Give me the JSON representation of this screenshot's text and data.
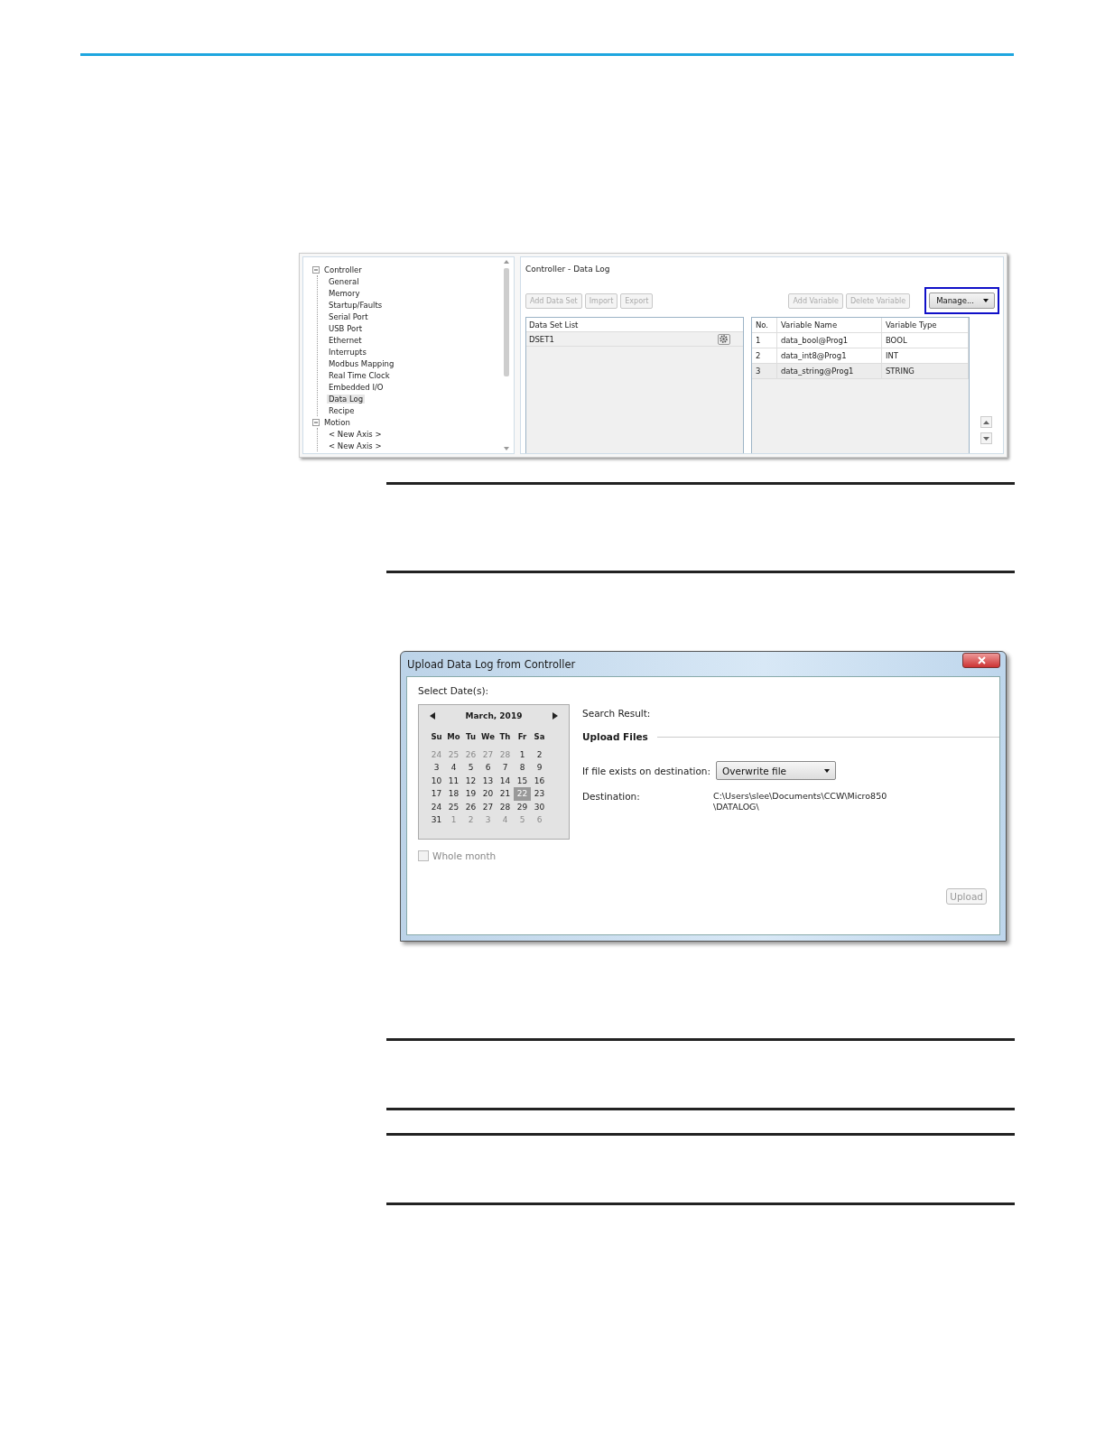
{
  "project_tree": {
    "items": [
      {
        "label": "Controller",
        "expanded": true,
        "selected": false,
        "children": [
          {
            "label": "General",
            "selected": false
          },
          {
            "label": "Memory",
            "selected": false
          },
          {
            "label": "Startup/Faults",
            "selected": false
          },
          {
            "label": "Serial Port",
            "selected": false
          },
          {
            "label": "USB Port",
            "selected": false
          },
          {
            "label": "Ethernet",
            "selected": false
          },
          {
            "label": "Interrupts",
            "selected": false
          },
          {
            "label": "Modbus Mapping",
            "selected": false
          },
          {
            "label": "Real Time Clock",
            "selected": false
          },
          {
            "label": "Embedded I/O",
            "selected": false
          },
          {
            "label": "Data Log",
            "selected": true
          },
          {
            "label": "Recipe",
            "selected": false
          }
        ]
      },
      {
        "label": "Motion",
        "expanded": true,
        "selected": false,
        "children": [
          {
            "label": "< New Axis >",
            "selected": false
          },
          {
            "label": "< New Axis >",
            "selected": false
          }
        ]
      }
    ]
  },
  "data_log_panel": {
    "title": "Controller - Data Log",
    "left_buttons": [
      {
        "label": "Add Data Set",
        "disabled": true
      },
      {
        "label": "Import",
        "disabled": true
      },
      {
        "label": "Export",
        "disabled": true
      }
    ],
    "right_buttons": [
      {
        "label": "Add Variable",
        "disabled": true
      },
      {
        "label": "Delete Variable",
        "disabled": true
      }
    ],
    "manage_button": {
      "label": "Manage...",
      "highlighted": true
    },
    "data_set_list": {
      "header": "Data Set List",
      "rows": [
        {
          "name": "DSET1"
        }
      ]
    },
    "variables": {
      "columns": [
        "No.",
        "Variable Name",
        "Variable Type"
      ],
      "rows": [
        {
          "no": "1",
          "name": "data_bool@Prog1",
          "type": "BOOL",
          "selected": false
        },
        {
          "no": "2",
          "name": "data_int8@Prog1",
          "type": "INT",
          "selected": false
        },
        {
          "no": "3",
          "name": "data_string@Prog1",
          "type": "STRING",
          "selected": true
        }
      ]
    }
  },
  "upload_dialog": {
    "title": "Upload Data Log from Controller",
    "select_label": "Select Date(s):",
    "calendar": {
      "month": "March, 2019",
      "weekdays": [
        "Su",
        "Mo",
        "Tu",
        "We",
        "Th",
        "Fr",
        "Sa"
      ],
      "weeks": [
        [
          {
            "label": "24",
            "muted": true,
            "selected": false
          },
          {
            "label": "25",
            "muted": true,
            "selected": false
          },
          {
            "label": "26",
            "muted": true,
            "selected": false
          },
          {
            "label": "27",
            "muted": true,
            "selected": false
          },
          {
            "label": "28",
            "muted": true,
            "selected": false
          },
          {
            "label": "1",
            "muted": false,
            "selected": false
          },
          {
            "label": "2",
            "muted": false,
            "selected": false
          }
        ],
        [
          {
            "label": "3",
            "muted": false,
            "selected": false
          },
          {
            "label": "4",
            "muted": false,
            "selected": false
          },
          {
            "label": "5",
            "muted": false,
            "selected": false
          },
          {
            "label": "6",
            "muted": false,
            "selected": false
          },
          {
            "label": "7",
            "muted": false,
            "selected": false
          },
          {
            "label": "8",
            "muted": false,
            "selected": false
          },
          {
            "label": "9",
            "muted": false,
            "selected": false
          }
        ],
        [
          {
            "label": "10",
            "muted": false,
            "selected": false
          },
          {
            "label": "11",
            "muted": false,
            "selected": false
          },
          {
            "label": "12",
            "muted": false,
            "selected": false
          },
          {
            "label": "13",
            "muted": false,
            "selected": false
          },
          {
            "label": "14",
            "muted": false,
            "selected": false
          },
          {
            "label": "15",
            "muted": false,
            "selected": false
          },
          {
            "label": "16",
            "muted": false,
            "selected": false
          }
        ],
        [
          {
            "label": "17",
            "muted": false,
            "selected": false
          },
          {
            "label": "18",
            "muted": false,
            "selected": false
          },
          {
            "label": "19",
            "muted": false,
            "selected": false
          },
          {
            "label": "20",
            "muted": false,
            "selected": false
          },
          {
            "label": "21",
            "muted": false,
            "selected": false
          },
          {
            "label": "22",
            "muted": false,
            "selected": true
          },
          {
            "label": "23",
            "muted": false,
            "selected": false
          }
        ],
        [
          {
            "label": "24",
            "muted": false,
            "selected": false
          },
          {
            "label": "25",
            "muted": false,
            "selected": false
          },
          {
            "label": "26",
            "muted": false,
            "selected": false
          },
          {
            "label": "27",
            "muted": false,
            "selected": false
          },
          {
            "label": "28",
            "muted": false,
            "selected": false
          },
          {
            "label": "29",
            "muted": false,
            "selected": false
          },
          {
            "label": "30",
            "muted": false,
            "selected": false
          }
        ],
        [
          {
            "label": "31",
            "muted": false,
            "selected": false
          },
          {
            "label": "1",
            "muted": true,
            "selected": false
          },
          {
            "label": "2",
            "muted": true,
            "selected": false
          },
          {
            "label": "3",
            "muted": true,
            "selected": false
          },
          {
            "label": "4",
            "muted": true,
            "selected": false
          },
          {
            "label": "5",
            "muted": true,
            "selected": false
          },
          {
            "label": "6",
            "muted": true,
            "selected": false
          }
        ]
      ]
    },
    "whole_month": {
      "label": "Whole month",
      "checked": false,
      "disabled": true
    },
    "search_result_label": "Search Result:",
    "section_title": "Upload Files",
    "if_exists_label": "If file exists on destination:",
    "if_exists_value": "Overwrite file",
    "destination_label": "Destination:",
    "destination_lines": [
      "C:\\Users\\slee\\Documents\\CCW\\Micro850",
      "\\DATALOG\\"
    ],
    "upload_button": {
      "label": "Upload",
      "disabled": true
    }
  }
}
